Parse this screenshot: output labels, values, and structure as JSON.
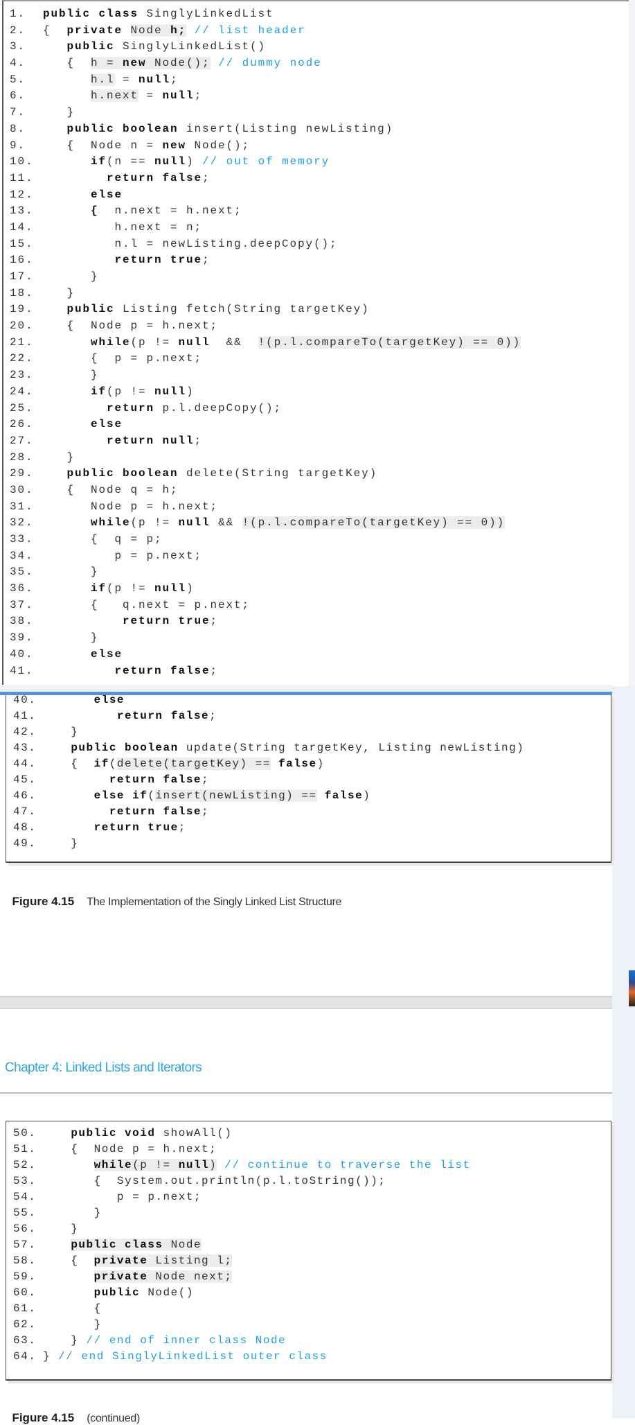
{
  "boxes": [
    {
      "id": "box1",
      "lines": [
        {
          "num": "1.",
          "segs": [
            {
              "t": "public class",
              "b": 1
            },
            {
              "t": " SinglyLinkedList"
            }
          ]
        },
        {
          "num": "2.",
          "segs": [
            {
              "t": "{  "
            },
            {
              "t": "private",
              "b": 1
            },
            {
              "t": " "
            },
            {
              "t": "Node ",
              "h": 1
            },
            {
              "t": "h;",
              "b": 1,
              "h": 1
            },
            {
              "t": " "
            },
            {
              "t": "// list header",
              "c": 1
            }
          ]
        },
        {
          "num": "3.",
          "segs": [
            {
              "t": "   "
            },
            {
              "t": "public",
              "b": 1
            },
            {
              "t": " SinglyLinkedList()"
            }
          ]
        },
        {
          "num": "4.",
          "segs": [
            {
              "t": "   {  "
            },
            {
              "t": "h = ",
              "h": 1
            },
            {
              "t": "new",
              "b": 1,
              "h": 1
            },
            {
              "t": " Node();",
              "h": 1
            },
            {
              "t": " "
            },
            {
              "t": "// dummy node",
              "c": 1
            }
          ]
        },
        {
          "num": "5.",
          "segs": [
            {
              "t": "      "
            },
            {
              "t": "h.l",
              "h": 1
            },
            {
              "t": " = "
            },
            {
              "t": "null",
              "b": 1
            },
            {
              "t": ";"
            }
          ]
        },
        {
          "num": "6.",
          "segs": [
            {
              "t": "      "
            },
            {
              "t": "h.next",
              "h": 1
            },
            {
              "t": " = "
            },
            {
              "t": "null",
              "b": 1
            },
            {
              "t": ";"
            }
          ]
        },
        {
          "num": "7.",
          "segs": [
            {
              "t": "   }"
            }
          ]
        },
        {
          "num": "8.",
          "segs": [
            {
              "t": "   "
            },
            {
              "t": "public boolean",
              "b": 1
            },
            {
              "t": " insert(Listing newListing)"
            }
          ]
        },
        {
          "num": "9.",
          "segs": [
            {
              "t": "   {  Node n = "
            },
            {
              "t": "new",
              "b": 1
            },
            {
              "t": " Node();"
            }
          ]
        },
        {
          "num": "10.",
          "segs": [
            {
              "t": "      "
            },
            {
              "t": "if",
              "b": 1
            },
            {
              "t": "(n == "
            },
            {
              "t": "null",
              "b": 1
            },
            {
              "t": ") "
            },
            {
              "t": "// out of memory",
              "c": 1
            }
          ]
        },
        {
          "num": "11.",
          "segs": [
            {
              "t": "        "
            },
            {
              "t": "return false",
              "b": 1
            },
            {
              "t": ";"
            }
          ]
        },
        {
          "num": "12.",
          "segs": [
            {
              "t": "      "
            },
            {
              "t": "else",
              "b": 1
            }
          ]
        },
        {
          "num": "13.",
          "segs": [
            {
              "t": "      "
            },
            {
              "t": "{",
              "b": 1
            },
            {
              "t": "  n.next = h.next;"
            }
          ]
        },
        {
          "num": "14.",
          "segs": [
            {
              "t": "         h.next = n;"
            }
          ]
        },
        {
          "num": "15.",
          "segs": [
            {
              "t": "         n.l = newListing.deepCopy();"
            }
          ]
        },
        {
          "num": "16.",
          "segs": [
            {
              "t": "         "
            },
            {
              "t": "return true",
              "b": 1
            },
            {
              "t": ";"
            }
          ]
        },
        {
          "num": "17.",
          "segs": [
            {
              "t": "      }"
            }
          ]
        },
        {
          "num": "18.",
          "segs": [
            {
              "t": "   }"
            }
          ]
        },
        {
          "num": "19.",
          "segs": [
            {
              "t": "   "
            },
            {
              "t": "public",
              "b": 1
            },
            {
              "t": " Listing fetch(String targetKey)"
            }
          ]
        },
        {
          "num": "20.",
          "segs": [
            {
              "t": "   {  Node p = h.next;"
            }
          ]
        },
        {
          "num": "21.",
          "segs": [
            {
              "t": "      "
            },
            {
              "t": "while",
              "b": 1
            },
            {
              "t": "(p != "
            },
            {
              "t": "null",
              "b": 1
            },
            {
              "t": "  &&  "
            },
            {
              "t": "!(p.l.compareTo(targetKey) == 0))",
              "h": 1
            }
          ]
        },
        {
          "num": "22.",
          "segs": [
            {
              "t": "      {  p = p.next;"
            }
          ]
        },
        {
          "num": "23.",
          "segs": [
            {
              "t": "      }"
            }
          ]
        },
        {
          "num": "24.",
          "segs": [
            {
              "t": "      "
            },
            {
              "t": "if",
              "b": 1
            },
            {
              "t": "(p != "
            },
            {
              "t": "null",
              "b": 1
            },
            {
              "t": ")"
            }
          ]
        },
        {
          "num": "25.",
          "segs": [
            {
              "t": "        "
            },
            {
              "t": "return",
              "b": 1
            },
            {
              "t": " p.l.deepCopy();"
            }
          ]
        },
        {
          "num": "26.",
          "segs": [
            {
              "t": "      "
            },
            {
              "t": "else",
              "b": 1
            }
          ]
        },
        {
          "num": "27.",
          "segs": [
            {
              "t": "        "
            },
            {
              "t": "return null",
              "b": 1
            },
            {
              "t": ";"
            }
          ]
        },
        {
          "num": "28.",
          "segs": [
            {
              "t": "   }"
            }
          ]
        },
        {
          "num": "29.",
          "segs": [
            {
              "t": "   "
            },
            {
              "t": "public boolean",
              "b": 1
            },
            {
              "t": " delete(String targetKey)"
            }
          ]
        },
        {
          "num": "30.",
          "segs": [
            {
              "t": "   {  Node q = h;"
            }
          ]
        },
        {
          "num": "31.",
          "segs": [
            {
              "t": "      Node p = h.next;"
            }
          ]
        },
        {
          "num": "32.",
          "segs": [
            {
              "t": "      "
            },
            {
              "t": "while",
              "b": 1
            },
            {
              "t": "(p != "
            },
            {
              "t": "null",
              "b": 1
            },
            {
              "t": " && "
            },
            {
              "t": "!(p.l.compareTo(targetKey) == 0))",
              "h": 1
            }
          ]
        },
        {
          "num": "33.",
          "segs": [
            {
              "t": "      {  q = p;"
            }
          ]
        },
        {
          "num": "34.",
          "segs": [
            {
              "t": "         p = p.next;"
            }
          ]
        },
        {
          "num": "35.",
          "segs": [
            {
              "t": "      }"
            }
          ]
        },
        {
          "num": "36.",
          "segs": [
            {
              "t": "      "
            },
            {
              "t": "if",
              "b": 1
            },
            {
              "t": "(p != "
            },
            {
              "t": "null",
              "b": 1
            },
            {
              "t": ")"
            }
          ]
        },
        {
          "num": "37.",
          "segs": [
            {
              "t": "      {   q.next = p.next;"
            }
          ]
        },
        {
          "num": "38.",
          "segs": [
            {
              "t": "          "
            },
            {
              "t": "return true",
              "b": 1
            },
            {
              "t": ";"
            }
          ]
        },
        {
          "num": "39.",
          "segs": [
            {
              "t": "      }"
            }
          ]
        },
        {
          "num": "40.",
          "segs": [
            {
              "t": "      "
            },
            {
              "t": "else",
              "b": 1
            }
          ]
        },
        {
          "num": "41.",
          "segs": [
            {
              "t": "         "
            },
            {
              "t": "return false",
              "b": 1
            },
            {
              "t": ";"
            }
          ]
        }
      ]
    },
    {
      "id": "box2",
      "lines": [
        {
          "num": "40.",
          "segs": [
            {
              "t": "      "
            },
            {
              "t": "else",
              "b": 1
            }
          ]
        },
        {
          "num": "41.",
          "segs": [
            {
              "t": "         "
            },
            {
              "t": "return false",
              "b": 1
            },
            {
              "t": ";"
            }
          ]
        },
        {
          "num": "42.",
          "segs": [
            {
              "t": "   }"
            }
          ]
        },
        {
          "num": "43.",
          "segs": [
            {
              "t": "   "
            },
            {
              "t": "public boolean",
              "b": 1
            },
            {
              "t": " update(String targetKey, Listing newListing)"
            }
          ]
        },
        {
          "num": "44.",
          "segs": [
            {
              "t": "   {  "
            },
            {
              "t": "if",
              "b": 1
            },
            {
              "t": "("
            },
            {
              "t": "delete(targetKey) ==",
              "h": 1
            },
            {
              "t": " "
            },
            {
              "t": "false",
              "b": 1
            },
            {
              "t": ")"
            }
          ]
        },
        {
          "num": "45.",
          "segs": [
            {
              "t": "        "
            },
            {
              "t": "return false",
              "b": 1
            },
            {
              "t": ";"
            }
          ]
        },
        {
          "num": "46.",
          "segs": [
            {
              "t": "      "
            },
            {
              "t": "else if",
              "b": 1
            },
            {
              "t": "("
            },
            {
              "t": "insert(newListing) ==",
              "h": 1
            },
            {
              "t": " "
            },
            {
              "t": "false",
              "b": 1
            },
            {
              "t": ")"
            }
          ]
        },
        {
          "num": "47.",
          "segs": [
            {
              "t": "        "
            },
            {
              "t": "return false",
              "b": 1
            },
            {
              "t": ";"
            }
          ]
        },
        {
          "num": "48.",
          "segs": [
            {
              "t": "      "
            },
            {
              "t": "return true",
              "b": 1
            },
            {
              "t": ";"
            }
          ]
        },
        {
          "num": "49.",
          "segs": [
            {
              "t": "   }"
            }
          ]
        }
      ]
    },
    {
      "id": "box3",
      "lines": [
        {
          "num": "50.",
          "segs": [
            {
              "t": "   "
            },
            {
              "t": "public void",
              "b": 1
            },
            {
              "t": " showAll()"
            }
          ]
        },
        {
          "num": "51.",
          "segs": [
            {
              "t": "   {  Node p = h.next;"
            }
          ]
        },
        {
          "num": "52.",
          "segs": [
            {
              "t": "      "
            },
            {
              "t": "while",
              "b": 1,
              "h": 1
            },
            {
              "t": "(p != ",
              "h": 1
            },
            {
              "t": "null",
              "b": 1,
              "h": 1
            },
            {
              "t": ")",
              "h": 1
            },
            {
              "t": " "
            },
            {
              "t": "// continue to traverse the list",
              "c": 1
            }
          ]
        },
        {
          "num": "53.",
          "segs": [
            {
              "t": "      {  System.out.println(p.l.toString());"
            }
          ]
        },
        {
          "num": "54.",
          "segs": [
            {
              "t": "         p = p.next;"
            }
          ]
        },
        {
          "num": "55.",
          "segs": [
            {
              "t": "      }"
            }
          ]
        },
        {
          "num": "56.",
          "segs": [
            {
              "t": "   }"
            }
          ]
        },
        {
          "num": "57.",
          "segs": [
            {
              "t": "   "
            },
            {
              "t": "public class",
              "b": 1,
              "h": 1
            },
            {
              "t": " Node",
              "h": 1
            }
          ]
        },
        {
          "num": "58.",
          "segs": [
            {
              "t": "   {  "
            },
            {
              "t": "private",
              "b": 1,
              "h": 1
            },
            {
              "t": " Listing l;",
              "h": 1
            }
          ]
        },
        {
          "num": "59.",
          "segs": [
            {
              "t": "      "
            },
            {
              "t": "private",
              "b": 1,
              "h": 1
            },
            {
              "t": " Node next;",
              "h": 1
            }
          ]
        },
        {
          "num": "60.",
          "segs": [
            {
              "t": "      "
            },
            {
              "t": "public",
              "b": 1
            },
            {
              "t": " Node()"
            }
          ]
        },
        {
          "num": "61.",
          "segs": [
            {
              "t": "      {"
            }
          ]
        },
        {
          "num": "62.",
          "segs": [
            {
              "t": "      }"
            }
          ]
        },
        {
          "num": "63.",
          "segs": [
            {
              "t": "   } "
            },
            {
              "t": "// end of inner class Node",
              "c": 1
            }
          ]
        },
        {
          "num": "64.",
          "inline": 1,
          "segs": [
            {
              "t": "} "
            },
            {
              "t": "// end SinglyLinkedList outer class",
              "c": 1
            }
          ]
        }
      ]
    }
  ],
  "caption1": {
    "label": "Figure 4.15",
    "text": "The Implementation of the Singly Linked List Structure"
  },
  "chapter_header": "Chapter 4: Linked Lists and Iterators",
  "caption2": {
    "label": "Figure 4.15",
    "text": "(continued)"
  },
  "colors": {
    "comment": "#1aa0e8",
    "highlight": "#ececec",
    "chapter": "#2ba6e6",
    "divider": "#5b8fdc"
  }
}
